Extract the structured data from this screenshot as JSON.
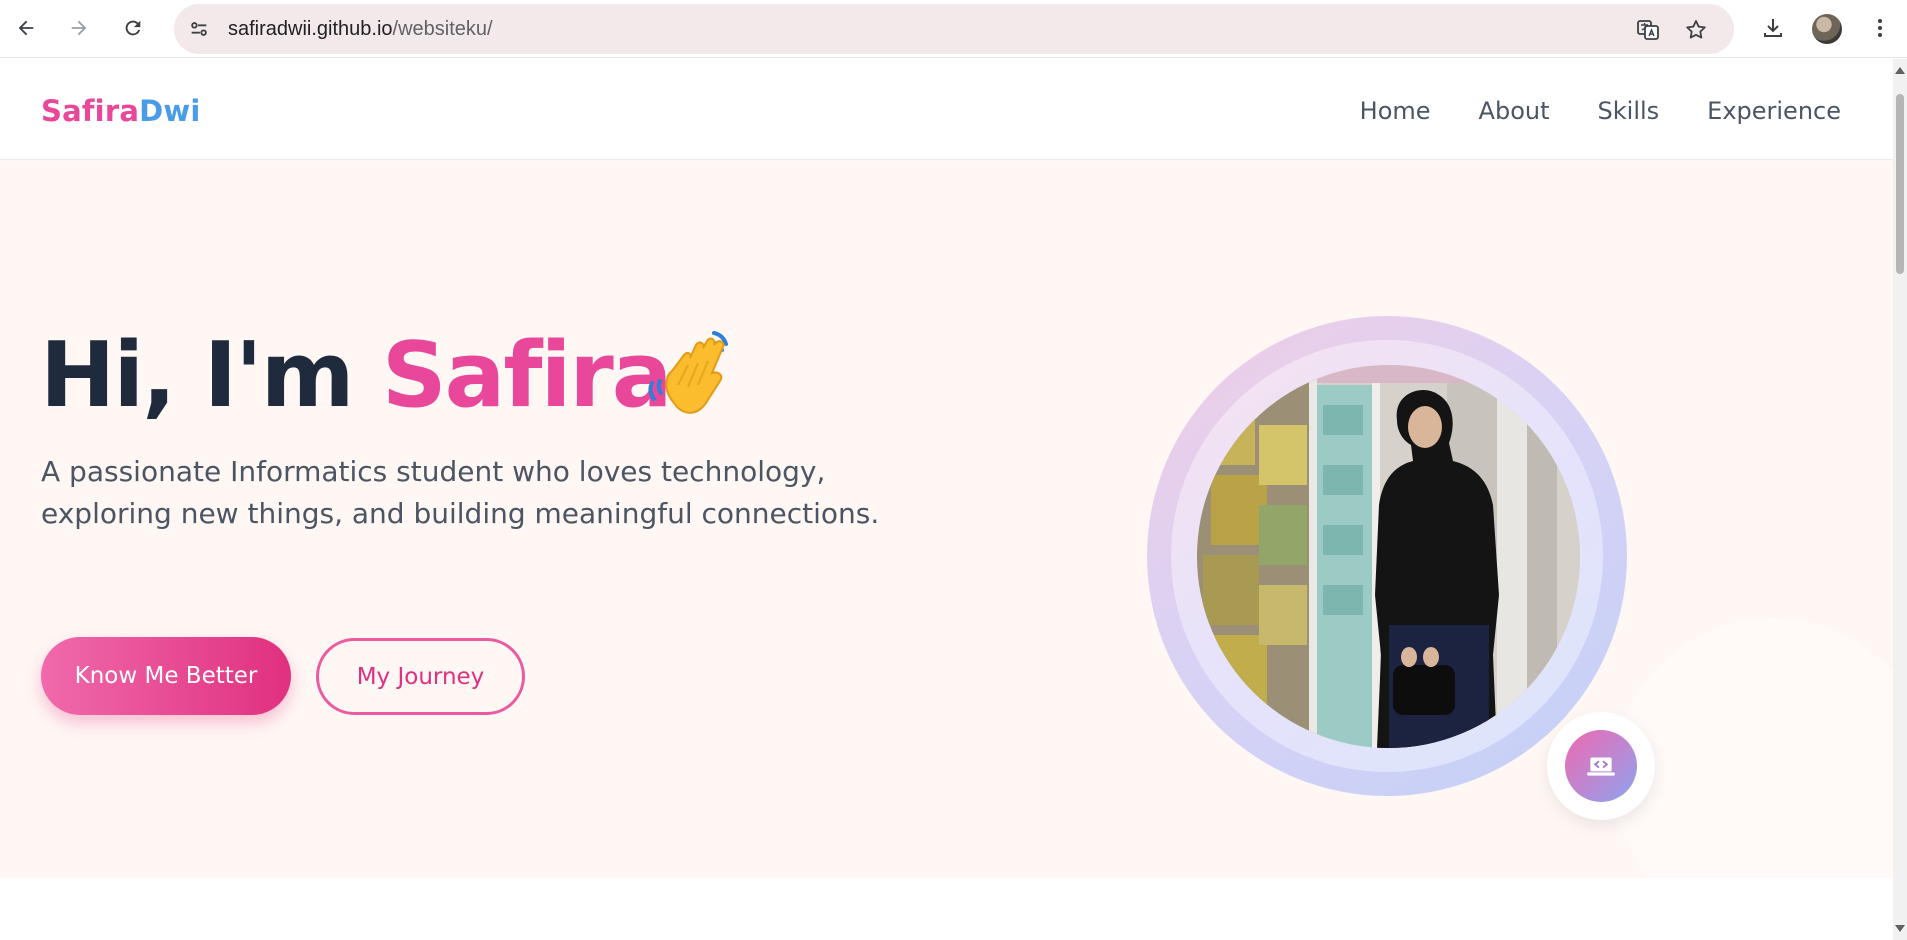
{
  "browser": {
    "url_host": "safiradwii.github.io",
    "url_path": "/websiteku/",
    "icons": [
      "back-icon",
      "forward-icon",
      "reload-icon",
      "site-info-icon",
      "translate-icon",
      "bookmark-star-icon",
      "download-icon",
      "profile-avatar",
      "menu-dots-icon"
    ]
  },
  "site": {
    "logo_first": "Safira",
    "logo_second": "Dwi",
    "nav": [
      "Home",
      "About",
      "Skills",
      "Experience"
    ]
  },
  "hero": {
    "greeting": "Hi, I'm ",
    "name": "Safira",
    "subtitle_line1": "A passionate Informatics student who loves technology,",
    "subtitle_line2": "exploring new things, and building meaningful connections.",
    "primary_button": "Know Me Better",
    "secondary_button": "My Journey",
    "badge_icon": "laptop-code-icon",
    "wave_icon": "waving-hand-icon"
  },
  "colors": {
    "accent_pink": "#e8479a",
    "accent_blue": "#4b9ce8",
    "heading": "#1f2a3d",
    "hero_bg": "#fff7f4"
  }
}
